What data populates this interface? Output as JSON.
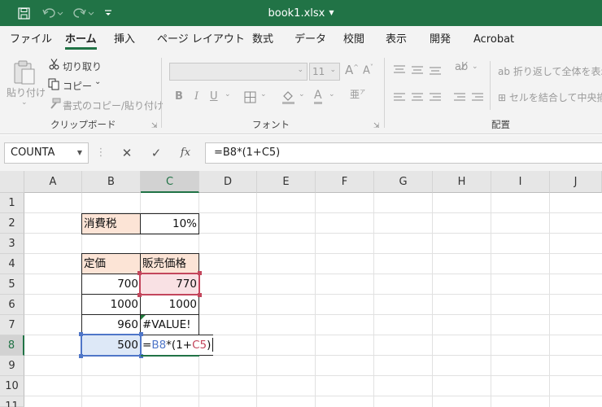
{
  "title_bar": {
    "filename": "book1.xlsx",
    "bg_color": "#217346"
  },
  "tabs": [
    {
      "label": "ファイル",
      "active": false
    },
    {
      "label": "ホーム",
      "active": true
    },
    {
      "label": "挿入",
      "active": false
    },
    {
      "label": "ページ レイアウト",
      "active": false
    },
    {
      "label": "数式",
      "active": false
    },
    {
      "label": "データ",
      "active": false
    },
    {
      "label": "校閲",
      "active": false
    },
    {
      "label": "表示",
      "active": false
    },
    {
      "label": "開発",
      "active": false
    },
    {
      "label": "Acrobat",
      "active": false
    }
  ],
  "ribbon": {
    "paste_label": "貼り付け",
    "cut_label": "切り取り",
    "copy_label": "コピー",
    "format_painter_label": "書式のコピー/貼り付け",
    "clipboard_group": "クリップボード",
    "font_size": "11",
    "font_group": "フォント",
    "wrap_text_label": "折り返して全体を表示す",
    "merge_center_label": "セルを結合して中央揃",
    "alignment_group": "配置"
  },
  "formula_bar": {
    "name_box": "COUNTA",
    "formula": "=B8*(1+C5)"
  },
  "columns": [
    "A",
    "B",
    "C",
    "D",
    "E",
    "F",
    "G",
    "H",
    "I",
    "J"
  ],
  "rows": [
    "1",
    "2",
    "3",
    "4",
    "5",
    "6",
    "7",
    "8",
    "9",
    "10",
    "11"
  ],
  "cells": {
    "B2": "消費税",
    "C2": "10%",
    "B4": "定価",
    "C4": "販売価格",
    "B5": "700",
    "C5": "770",
    "B6": "1000",
    "C6": "1000",
    "B7": "960",
    "C7": "#VALUE!",
    "B8": "500"
  },
  "edit_formula": {
    "eq": "=",
    "ref1": "B8",
    "mid": "*(1+",
    "ref2": "C5",
    "close": ")"
  },
  "colors": {
    "accent": "#217346",
    "ref_red": "#c3465c",
    "ref_blue": "#4f76c8",
    "header_fill": "#fce4d6"
  }
}
